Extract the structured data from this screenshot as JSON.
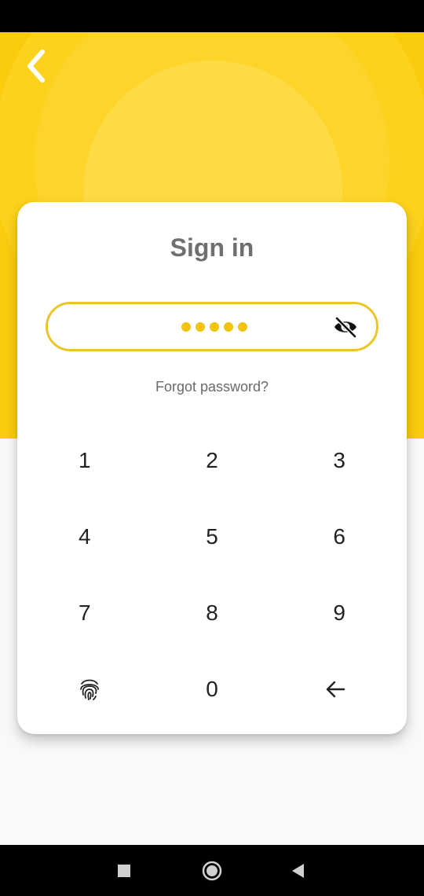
{
  "header": {
    "back_icon": "chevron-left-icon"
  },
  "card": {
    "title": "Sign in",
    "pin": {
      "entered_digits": 5,
      "mask_color": "#f2c40f",
      "border_color": "#eac726",
      "visibility_icon": "eye-off-icon"
    },
    "forgot_password": "Forgot password?"
  },
  "keypad": {
    "keys": [
      "1",
      "2",
      "3",
      "4",
      "5",
      "6",
      "7",
      "8",
      "9"
    ],
    "zero": "0",
    "fingerprint_icon": "fingerprint-icon",
    "backspace_icon": "arrow-left-icon"
  },
  "theme": {
    "accent": "#fbcc0d",
    "title_color": "#6f6f6f"
  },
  "system_nav": {
    "recents_icon": "square-icon",
    "home_icon": "circle-icon",
    "back_icon": "triangle-back-icon"
  }
}
